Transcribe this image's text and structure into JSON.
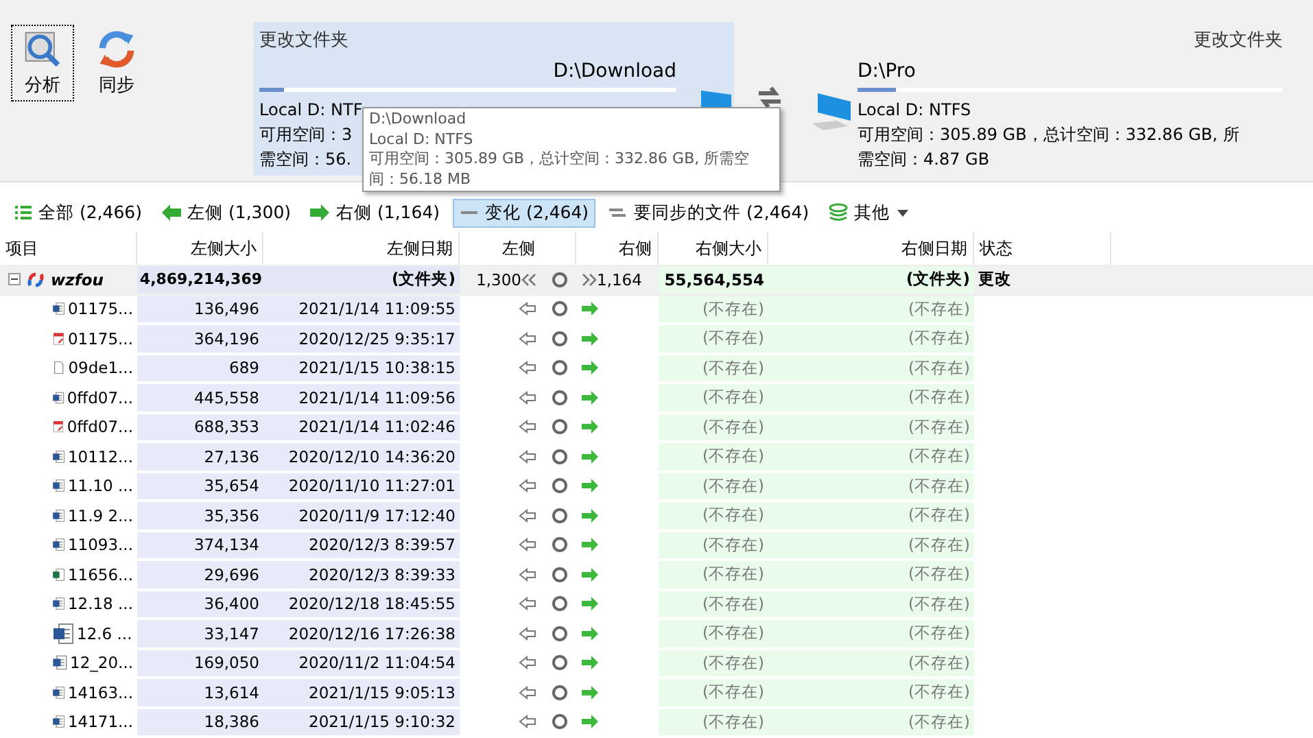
{
  "toolbar": {
    "buttons": [
      {
        "label": "分析",
        "kind": "analyze",
        "selected": true
      },
      {
        "label": "同步",
        "kind": "sync",
        "selected": false
      }
    ]
  },
  "left_folder": {
    "change_label": "更改文件夹",
    "path": "D:\\Download",
    "level": 0.06,
    "lines": [
      "Local D: NTF",
      "可用空间：3",
      "需空间：56."
    ]
  },
  "right_folder": {
    "change_label": "更改文件夹",
    "path": "D:\\Pro",
    "level": 0.09,
    "lines": [
      "Local D: NTFS",
      "可用空间：305.89 GB，总计空间：332.86 GB, 所",
      "需空间：4.87 GB"
    ]
  },
  "tooltip": {
    "lines": [
      "D:\\Download",
      "Local D: NTFS",
      "可用空间：305.89 GB，总计空间：332.86 GB, 所需空",
      "间：56.18 MB"
    ]
  },
  "filters": [
    {
      "label": "全部 (2,466)",
      "kind": "all",
      "selected": false
    },
    {
      "label": "左侧 (1,300)",
      "kind": "left",
      "selected": false
    },
    {
      "label": "右侧 (1,164)",
      "kind": "right",
      "selected": false
    },
    {
      "label": "变化 (2,464)",
      "kind": "changed",
      "selected": true
    },
    {
      "label": "要同步的文件 (2,464)",
      "kind": "sync",
      "selected": false
    },
    {
      "label": "其他",
      "kind": "other",
      "selected": false
    }
  ],
  "table": {
    "columns": [
      "项目",
      "左侧大小",
      "左侧日期",
      "左侧",
      "右侧",
      "右侧大小",
      "右侧日期",
      "状态"
    ],
    "folder": {
      "name": "wzfou",
      "expanded": true,
      "left_size": "4,869,214,369",
      "left_date": "(文件夹)",
      "left_count": "1,300",
      "right_count": "1,164",
      "right_size": "55,564,554",
      "right_date": "(文件夹)",
      "status": "更改"
    },
    "rows": [
      {
        "kind": "word",
        "name": "01175...",
        "left_size": "136,496",
        "left_date": "2021/1/14 11:09:55",
        "right_size": "(不存在)",
        "right_date": "(不存在)"
      },
      {
        "kind": "pdf",
        "name": "01175...",
        "left_size": "364,196",
        "left_date": "2020/12/25 9:35:17",
        "right_size": "(不存在)",
        "right_date": "(不存在)"
      },
      {
        "kind": "blank",
        "name": "09de1...",
        "left_size": "689",
        "left_date": "2021/1/15 10:38:15",
        "right_size": "(不存在)",
        "right_date": "(不存在)"
      },
      {
        "kind": "word",
        "name": "0ffd07...",
        "left_size": "445,558",
        "left_date": "2021/1/14 11:09:56",
        "right_size": "(不存在)",
        "right_date": "(不存在)"
      },
      {
        "kind": "pdf",
        "name": "0ffd07...",
        "left_size": "688,353",
        "left_date": "2021/1/14 11:02:46",
        "right_size": "(不存在)",
        "right_date": "(不存在)"
      },
      {
        "kind": "word",
        "name": "10112...",
        "left_size": "27,136",
        "left_date": "2020/12/10 14:36:20",
        "right_size": "(不存在)",
        "right_date": "(不存在)"
      },
      {
        "kind": "word",
        "name": "11.10 ...",
        "left_size": "35,654",
        "left_date": "2020/11/10 11:27:01",
        "right_size": "(不存在)",
        "right_date": "(不存在)"
      },
      {
        "kind": "word",
        "name": "11.9 2...",
        "left_size": "35,356",
        "left_date": "2020/11/9 17:12:40",
        "right_size": "(不存在)",
        "right_date": "(不存在)"
      },
      {
        "kind": "word",
        "name": "11093...",
        "left_size": "374,134",
        "left_date": "2020/12/3 8:39:57",
        "right_size": "(不存在)",
        "right_date": "(不存在)"
      },
      {
        "kind": "excel",
        "name": "11656...",
        "left_size": "29,696",
        "left_date": "2020/12/3 8:39:33",
        "right_size": "(不存在)",
        "right_date": "(不存在)"
      },
      {
        "kind": "word",
        "name": "12.18 ...",
        "left_size": "36,400",
        "left_date": "2020/12/18 18:45:55",
        "right_size": "(不存在)",
        "right_date": "(不存在)"
      },
      {
        "kind": "word",
        "name": "12.6 ...",
        "left_size": "33,147",
        "left_date": "2020/12/16 17:26:38",
        "right_size": "(不存在)",
        "right_date": "(不存在)"
      },
      {
        "kind": "word",
        "name": "12_20...",
        "left_size": "169,050",
        "left_date": "2020/11/2 11:04:54",
        "right_size": "(不存在)",
        "right_date": "(不存在)"
      },
      {
        "kind": "word",
        "name": "14163...",
        "left_size": "13,614",
        "left_date": "2021/1/15 9:05:13",
        "right_size": "(不存在)",
        "right_date": "(不存在)"
      },
      {
        "kind": "word",
        "name": "14171...",
        "left_size": "18,386",
        "left_date": "2021/1/15 9:10:32",
        "right_size": "(不存在)",
        "right_date": "(不存在)"
      }
    ]
  }
}
